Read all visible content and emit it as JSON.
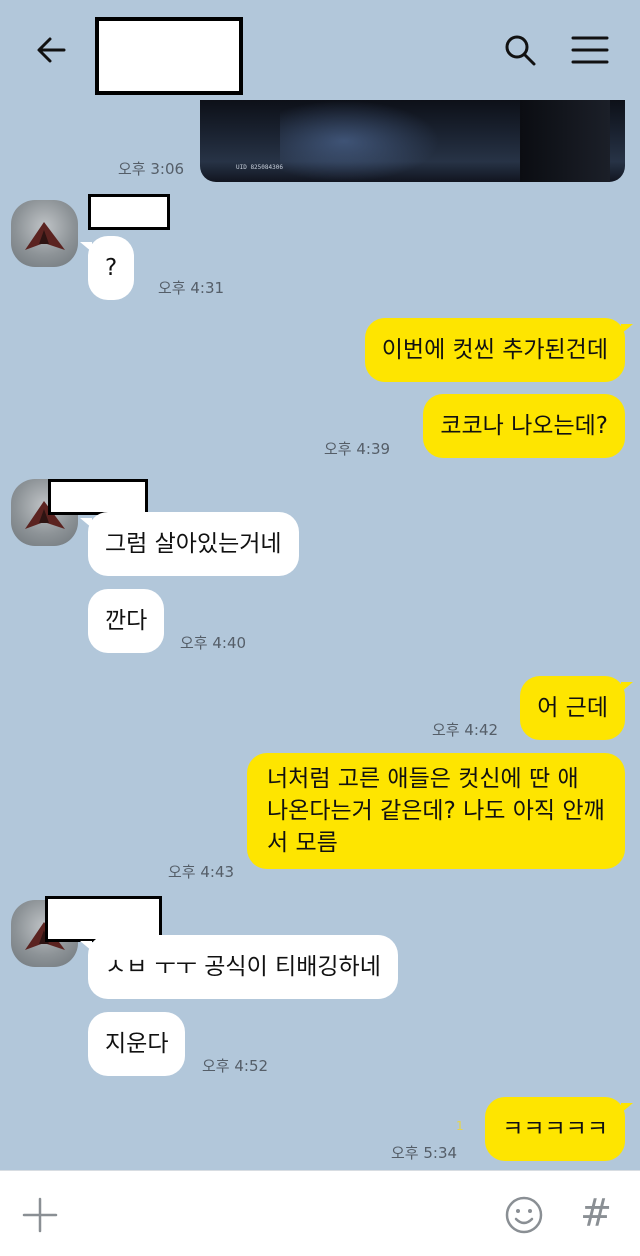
{
  "header": {
    "back_icon": "arrow-left-icon",
    "search_icon": "search-icon",
    "menu_icon": "hamburger-menu-icon"
  },
  "media": {
    "caption": "UID 825084306",
    "time": "오후 3:06"
  },
  "messages": [
    {
      "side": "in",
      "text": "?",
      "time": "오후 4:31"
    },
    {
      "side": "out",
      "text": "이번에 컷씬 추가된건데"
    },
    {
      "side": "out",
      "text": "코코나 나오는데?",
      "time": "오후 4:39"
    },
    {
      "side": "in",
      "text": "그럼 살아있는거네"
    },
    {
      "side": "in",
      "text": "깐다",
      "time": "오후 4:40"
    },
    {
      "side": "out",
      "text": "어 근데",
      "time": "오후 4:42"
    },
    {
      "side": "out",
      "text": "너처럼 고른 애들은 컷신에 딴 애 나온다는거 같은데? 나도 아직 안깨서 모름",
      "time": "오후 4:43"
    },
    {
      "side": "in",
      "text": "ㅅㅂ ㅜㅜ 공식이 티배깅하네"
    },
    {
      "side": "in",
      "text": "지운다",
      "time": "오후 4:52"
    },
    {
      "side": "out",
      "text": "ㅋㅋㅋㅋㅋ",
      "time": "오후 5:34",
      "unread": "1"
    }
  ],
  "input_bar": {
    "plus_icon": "plus-icon",
    "emoji_icon": "emoji-smile-icon",
    "hash_icon": "hash-icon",
    "hash_label": "#"
  },
  "colors": {
    "background": "#b2c7da",
    "outgoing_bubble": "#fee500",
    "incoming_bubble": "#ffffff",
    "unread_count": "#e6d54a"
  }
}
